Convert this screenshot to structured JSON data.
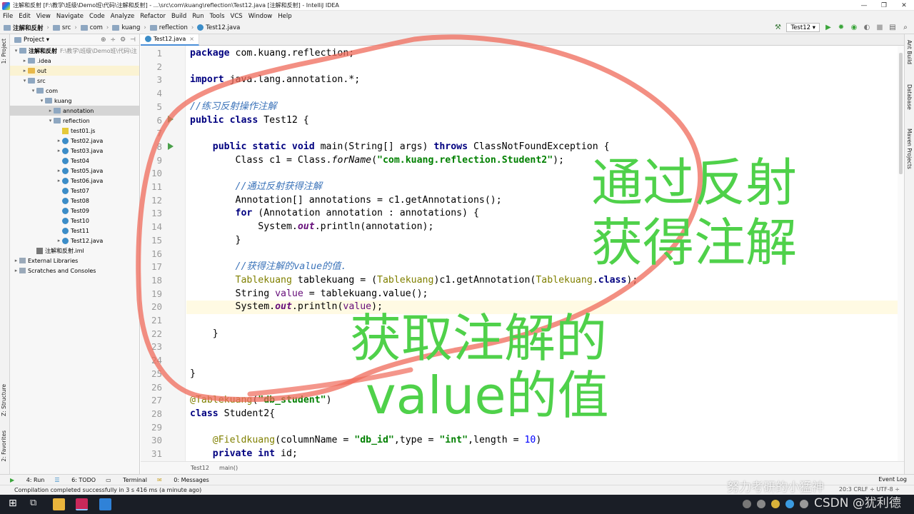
{
  "window": {
    "title": "注解和反射 [F:\\教学\\班级\\Demo班\\代码\\注解和反射] - ...\\src\\com\\kuang\\reflection\\Test12.java [注解和反射] - IntelliJ IDEA"
  },
  "menu": [
    "File",
    "Edit",
    "View",
    "Navigate",
    "Code",
    "Analyze",
    "Refactor",
    "Build",
    "Run",
    "Tools",
    "VCS",
    "Window",
    "Help"
  ],
  "breadcrumbs": [
    "注解和反射",
    "src",
    "com",
    "kuang",
    "reflection",
    "Test12.java"
  ],
  "run_config": "Test12",
  "left_strip": {
    "project": "1: Project",
    "structure": "Z: Structure",
    "favorites": "2: Favorites"
  },
  "right_strip": {
    "ant": "Ant Build",
    "database": "Database",
    "maven": "Maven Projects"
  },
  "project_panel": {
    "title": "Project",
    "root_label": "注解和反射",
    "root_path": "F:\\教学\\班级\\Demo班\\代码\\注",
    "items": [
      {
        "label": "注解和反射",
        "depth": 0,
        "arrow": "▾",
        "icon": "folder"
      },
      {
        "label": ".idea",
        "depth": 1,
        "arrow": "▸",
        "icon": "folder"
      },
      {
        "label": "out",
        "depth": 1,
        "arrow": "▸",
        "icon": "folder-y"
      },
      {
        "label": "src",
        "depth": 1,
        "arrow": "▾",
        "icon": "folder"
      },
      {
        "label": "com",
        "depth": 2,
        "arrow": "▾",
        "icon": "folder"
      },
      {
        "label": "kuang",
        "depth": 3,
        "arrow": "▾",
        "icon": "folder"
      },
      {
        "label": "annotation",
        "depth": 4,
        "arrow": "▸",
        "icon": "folder"
      },
      {
        "label": "reflection",
        "depth": 4,
        "arrow": "▾",
        "icon": "folder"
      },
      {
        "label": "test01.js",
        "depth": 5,
        "arrow": "",
        "icon": "js"
      },
      {
        "label": "Test02.java",
        "depth": 5,
        "arrow": "▸",
        "icon": "class"
      },
      {
        "label": "Test03.java",
        "depth": 5,
        "arrow": "▸",
        "icon": "class"
      },
      {
        "label": "Test04",
        "depth": 5,
        "arrow": "",
        "icon": "class"
      },
      {
        "label": "Test05.java",
        "depth": 5,
        "arrow": "▸",
        "icon": "class"
      },
      {
        "label": "Test06.java",
        "depth": 5,
        "arrow": "▸",
        "icon": "class"
      },
      {
        "label": "Test07",
        "depth": 5,
        "arrow": "",
        "icon": "class"
      },
      {
        "label": "Test08",
        "depth": 5,
        "arrow": "",
        "icon": "class"
      },
      {
        "label": "Test09",
        "depth": 5,
        "arrow": "",
        "icon": "class"
      },
      {
        "label": "Test10",
        "depth": 5,
        "arrow": "",
        "icon": "class"
      },
      {
        "label": "Test11",
        "depth": 5,
        "arrow": "",
        "icon": "class"
      },
      {
        "label": "Test12.java",
        "depth": 5,
        "arrow": "▸",
        "icon": "class"
      },
      {
        "label": "注解和反射.iml",
        "depth": 2,
        "arrow": "",
        "icon": "iml"
      },
      {
        "label": "External Libraries",
        "depth": 0,
        "arrow": "▸",
        "icon": "lib"
      },
      {
        "label": "Scratches and Consoles",
        "depth": 0,
        "arrow": "▸",
        "icon": "lib"
      }
    ]
  },
  "editor": {
    "tab": "Test12.java",
    "line_numbers": [
      "1",
      "2",
      "3",
      "4",
      "5",
      "6",
      "7",
      "8",
      "9",
      "10",
      "11",
      "12",
      "13",
      "14",
      "15",
      "16",
      "17",
      "18",
      "19",
      "20",
      "21",
      "22",
      "23",
      "24",
      "25",
      "26",
      "27",
      "28",
      "29",
      "30",
      "31"
    ],
    "code": {
      "l1a": "package",
      "l1b": " com.kuang.reflection;",
      "l3a": "import",
      "l3b": " java.lang.annotation.*;",
      "l5": "//练习反射操作注解",
      "l6a": "public class",
      "l6b": " Test12 {",
      "l8a": "    public static void",
      "l8b": " main(String[] args) ",
      "l8c": "throws",
      "l8d": " ClassNotFoundException {",
      "l9a": "        Class c1 = Class.",
      "l9b": "forName",
      "l9c": "(",
      "l9d": "\"com.kuang.reflection.Student2\"",
      "l9e": ");",
      "l11": "        //通过反射获得注解",
      "l12": "        Annotation[] annotations = c1.getAnnotations();",
      "l13a": "        for",
      "l13b": " (Annotation annotation : annotations) {",
      "l14a": "            System.",
      "l14b": "out",
      "l14c": ".println(annotation);",
      "l15": "        }",
      "l17": "        //获得注解的value的值.",
      "l18a": "        ",
      "l18b": "Tablekuang",
      "l18c": " tablekuang = (",
      "l18d": "Tablekuang",
      "l18e": ")c1.getAnnotation(",
      "l18f": "Tablekuang",
      "l18g": ".",
      "l18h": "class",
      "l18i": ");",
      "l19a": "        String ",
      "l19b": "value",
      "l19c": " = tablekuang.value();",
      "l20a": "        System.",
      "l20b": "out",
      "l20c": ".println(",
      "l20d": "value",
      "l20e": ");",
      "l22": "    }",
      "l25": "}",
      "l27a": "@Tablekuang",
      "l27b": "(",
      "l27c": "\"db_student\"",
      "l27d": ")",
      "l28a": "class",
      "l28b": " Student2{",
      "l30a": "    @Fieldkuang",
      "l30b": "(columnName = ",
      "l30c": "\"db_id\"",
      "l30d": ",type = ",
      "l30e": "\"int\"",
      "l30f": ",length = ",
      "l30g": "10",
      "l30h": ")",
      "l31a": "    private int",
      "l31b": " id;"
    },
    "footer_crumbs": [
      "Test12",
      "main()"
    ]
  },
  "toolwindows": {
    "run": "4: Run",
    "todo": "6: TODO",
    "terminal": "Terminal",
    "messages": "0: Messages",
    "event_log": "Event Log"
  },
  "status": {
    "message": "Compilation completed successfully in 3 s 416 ms (a minute ago)",
    "position": "20:3  CRLF ÷  UTF-8 ÷"
  },
  "overlay": {
    "line1": "通过反射",
    "line2": "获得注解",
    "line3": "获取注解的",
    "line4": "value的值",
    "watermark1": "努力考研的小猛神",
    "watermark2": "CSDN @犹利德",
    "text_color": "#4fd14a",
    "stroke_color": "#ef6a5a"
  },
  "taskbar": {
    "clock": ""
  }
}
